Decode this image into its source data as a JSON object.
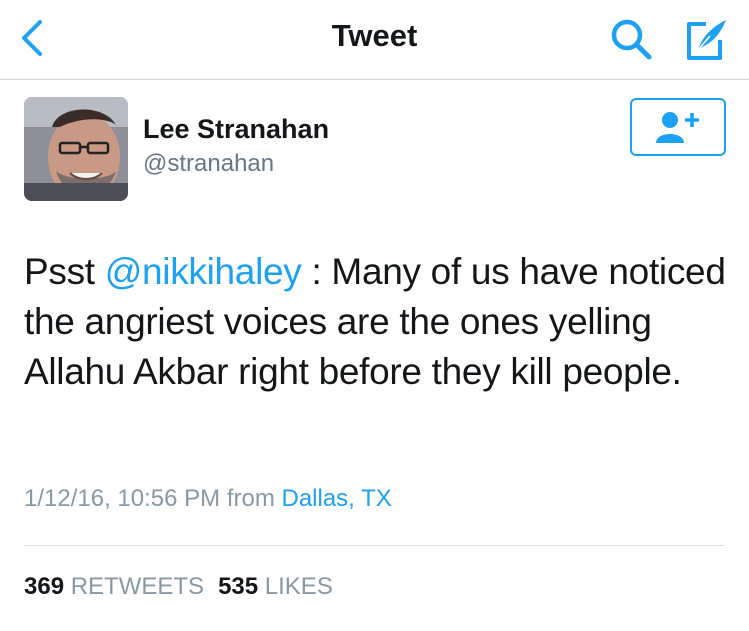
{
  "nav": {
    "title": "Tweet",
    "back_icon": "chevron-left-icon",
    "search_icon": "search-icon",
    "compose_icon": "compose-icon",
    "accent": "#1da1f2"
  },
  "user": {
    "name": "Lee Stranahan",
    "handle": "@stranahan",
    "follow_icon": "add-user-icon"
  },
  "tweet": {
    "prefix": "Psst ",
    "mention": "@nikkihaley",
    "body": " : Many of us have noticed the angriest voices are the ones yelling Allahu Akbar right before they kill people."
  },
  "meta": {
    "timestamp": "1/12/16, 10:56 PM",
    "from": "from",
    "location": "Dallas, TX"
  },
  "stats": {
    "retweets_count": "369",
    "retweets_label": "RETWEETS",
    "likes_count": "535",
    "likes_label": "LIKES"
  }
}
